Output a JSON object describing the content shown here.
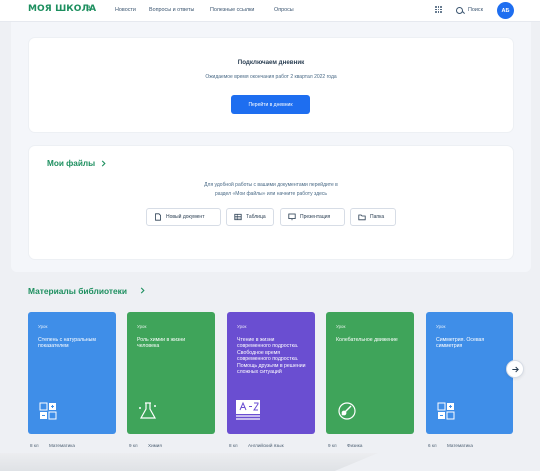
{
  "header": {
    "logo": "МОЯ ШКОЛА",
    "logo_mark": "β",
    "nav": [
      "Новости",
      "Вопросы и ответы",
      "Полезные ссылки",
      "Опросы"
    ],
    "search_label": "Поиск",
    "avatar_initials": "АБ"
  },
  "diary": {
    "title": "Подключаем дневник",
    "subtitle": "Ожидаемое время окончания работ 2 квартал 2022 года",
    "button": "Перейти в дневник"
  },
  "files": {
    "title": "Мои файлы",
    "desc_line1": "Для удобной работы с вашими документами перейдите в",
    "desc_line2": "раздел «Мои файлы» или начните работу здесь",
    "buttons": [
      "Новый документ",
      "Таблица",
      "Презентация",
      "Папка"
    ]
  },
  "library": {
    "title": "Материалы библиотеки",
    "cards": [
      {
        "kind": "Урок",
        "name": "Степень с натуральным показателем",
        "grade": "8 кл",
        "subject": "Математика",
        "color": "#3f8ee8",
        "icon": "calculator-icon"
      },
      {
        "kind": "Урок",
        "name": "Роль химии в жизни человека",
        "grade": "9 кл",
        "subject": "Химия",
        "color": "#3fa45a",
        "icon": "flask-icon"
      },
      {
        "kind": "Урок",
        "name": "Чтение в жизни современного подростка. Свободное время современного подростка. Помощь друзьям в решении сложных ситуаций",
        "grade": "8 кл",
        "subject": "Английский язык",
        "color": "#6a4ed1",
        "icon": "book-icon"
      },
      {
        "kind": "Урок",
        "name": "Колебательное движение",
        "grade": "9 кл",
        "subject": "Физика",
        "color": "#3fa45a",
        "icon": "pendulum-icon"
      },
      {
        "kind": "Урок",
        "name": "Симметрия. Осевая симметрия",
        "grade": "6 кл",
        "subject": "Математика",
        "color": "#3f8ee8",
        "icon": "calculator-icon"
      }
    ]
  },
  "colors": {
    "accent_green": "#1d8f5f",
    "primary_blue": "#1e6ef0"
  }
}
